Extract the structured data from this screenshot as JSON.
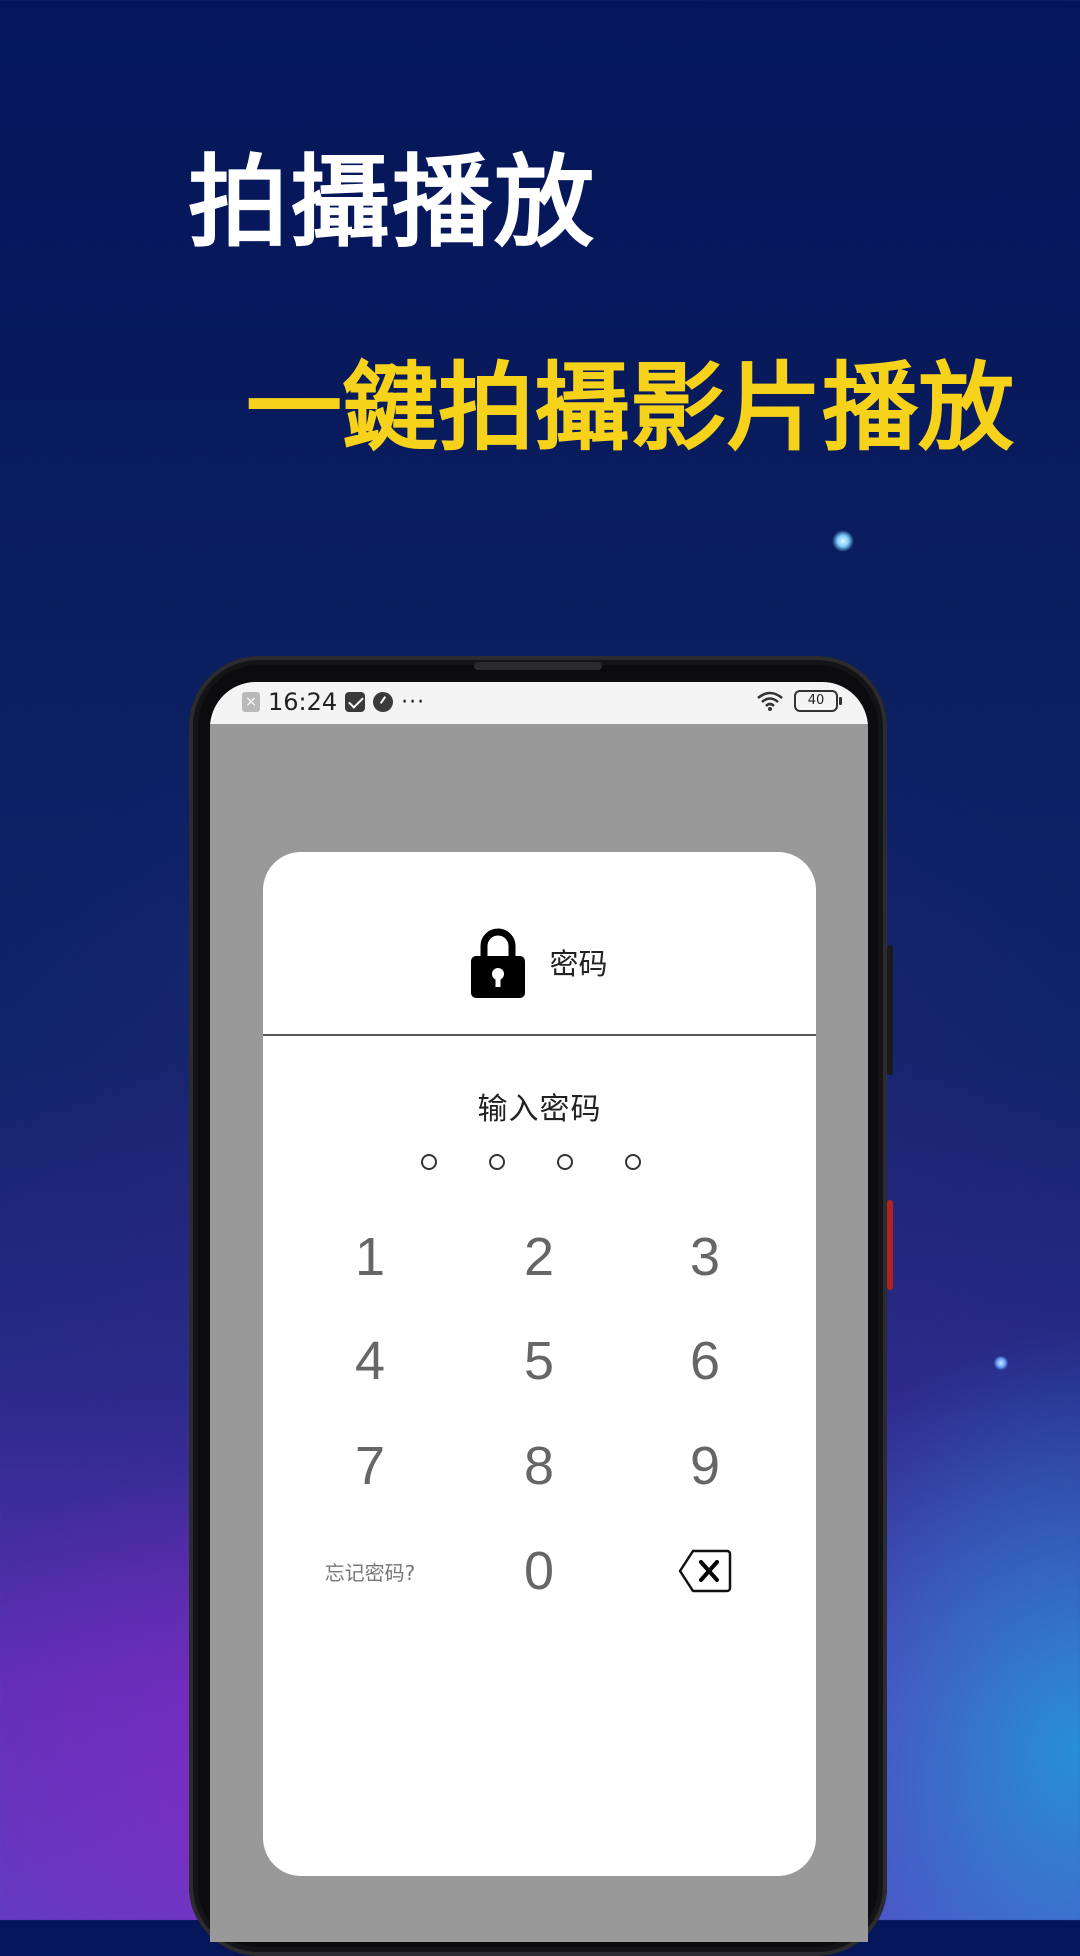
{
  "promo": {
    "headline": "拍攝播放",
    "subheadline": "一鍵拍攝影片播放"
  },
  "status_bar": {
    "time": "16:24",
    "more": "···",
    "battery": "40"
  },
  "dialog": {
    "title": "密码",
    "prompt": "输入密码",
    "pin_dots": 4,
    "keys": [
      "1",
      "2",
      "3",
      "4",
      "5",
      "6",
      "7",
      "8",
      "9",
      "0"
    ],
    "forgot_label": "忘记密码?"
  },
  "colors": {
    "headline": "#ffffff",
    "subheadline": "#f6d21a",
    "screen_overlay": "#999999",
    "dialog_bg": "#ffffff"
  },
  "icons": {
    "lock": "lock-icon",
    "backspace": "backspace-icon",
    "wifi": "wifi-icon",
    "battery": "battery-icon"
  }
}
